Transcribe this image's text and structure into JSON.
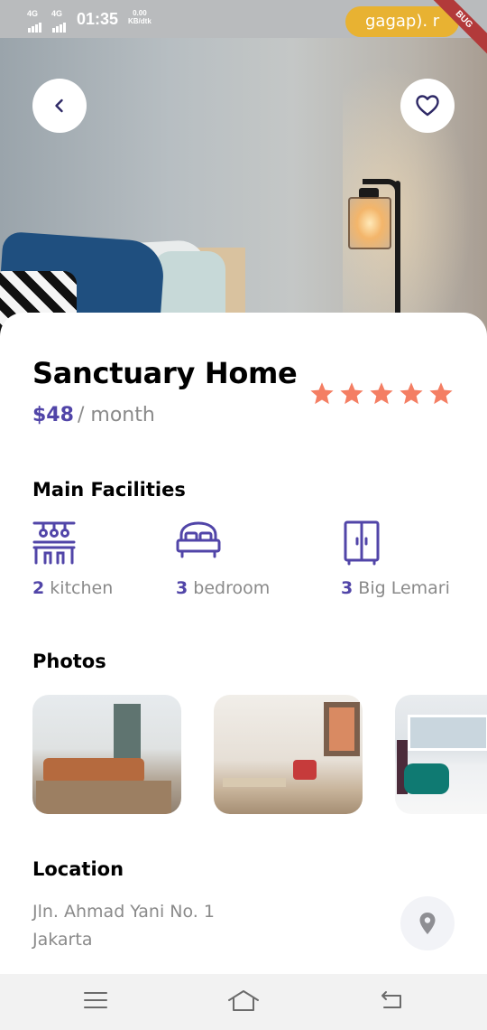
{
  "status_bar": {
    "network_1": "4G",
    "network_2": "4G",
    "time": "01:35",
    "speed_value": "0.00",
    "speed_unit": "KB/dtk",
    "pill_text": "gagap). r",
    "debug_label": "BUG"
  },
  "hero": {
    "back_icon": "chevron-left-icon",
    "favorite_icon": "heart-outline-icon"
  },
  "property": {
    "title": "Sanctuary Home",
    "price": "$48",
    "price_unit": "/ month",
    "rating": 5,
    "rating_max": 5,
    "star_color": "#f47e63"
  },
  "facilities": {
    "section_title": "Main Facilities",
    "items": [
      {
        "icon": "kitchen-icon",
        "count": "2",
        "name": "kitchen"
      },
      {
        "icon": "bedroom-icon",
        "count": "3",
        "name": "bedroom"
      },
      {
        "icon": "wardrobe-icon",
        "count": "3",
        "name": "Big Lemari"
      }
    ]
  },
  "photos": {
    "section_title": "Photos",
    "items": [
      "living-room-photo",
      "dining-room-photo",
      "bedroom-photo"
    ]
  },
  "location": {
    "section_title": "Location",
    "address_line_1": "Jln. Ahmad Yani No. 1",
    "address_line_2": "Jakarta",
    "map_icon": "map-pin-icon"
  },
  "navbar": {
    "items": [
      "menu-icon",
      "home-icon",
      "back-icon"
    ]
  },
  "colors": {
    "accent": "#5145a8",
    "muted_text": "#8a8a8a",
    "star": "#f47e63",
    "map_button_bg": "#f2f3f7"
  }
}
